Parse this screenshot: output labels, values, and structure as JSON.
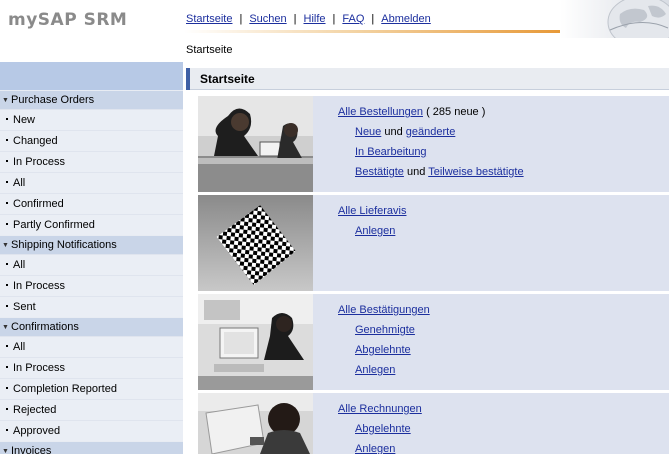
{
  "header": {
    "logo": "mySAP SRM",
    "nav": [
      {
        "label": "Startseite"
      },
      {
        "label": "Suchen"
      },
      {
        "label": "Hilfe"
      },
      {
        "label": "FAQ"
      },
      {
        "label": "Abmelden"
      }
    ],
    "separator": "|",
    "breadcrumb": "Startseite"
  },
  "sidebar": {
    "sections": [
      {
        "label": "Purchase Orders",
        "items": [
          "New",
          "Changed",
          "In Process",
          "All",
          "Confirmed",
          "Partly Confirmed"
        ]
      },
      {
        "label": "Shipping Notifications",
        "items": [
          "All",
          "In Process",
          "Sent"
        ]
      },
      {
        "label": "Confirmations",
        "items": [
          "All",
          "In Process",
          "Completion Reported",
          "Rejected",
          "Approved"
        ]
      },
      {
        "label": "Invoices",
        "items": []
      }
    ]
  },
  "main": {
    "title": "Startseite",
    "blocks": {
      "orders": {
        "all_link": "Alle Bestellungen",
        "count_text": "( 285 neue )",
        "new_link": "Neue",
        "and_1": "und",
        "changed_link": "geänderte",
        "in_process_link": "In Bearbeitung",
        "confirmed_link": "Bestätigte",
        "and_2": "und",
        "partly_confirmed_link": "Teilweise bestätigte"
      },
      "shipping": {
        "all_link": "Alle Lieferavis",
        "create_link": "Anlegen"
      },
      "confirmations": {
        "all_link": "Alle Bestätigungen",
        "approved_link": "Genehmigte",
        "rejected_link": "Abgelehnte",
        "create_link": "Anlegen"
      },
      "invoices": {
        "all_link": "Alle Rechnungen",
        "rejected_link": "Abgelehnte",
        "create_link": "Anlegen"
      }
    }
  },
  "colors": {
    "link": "#1c2f9e",
    "sidebar_header": "#b7c9e6",
    "sidebar_section": "#c9d5e8",
    "content_block": "#dde2ef",
    "accent_orange": "#e48a1c"
  }
}
